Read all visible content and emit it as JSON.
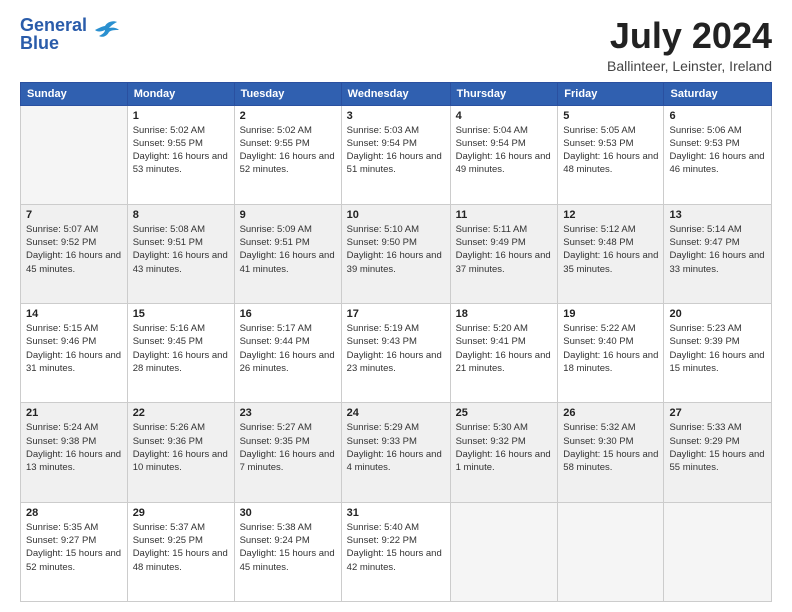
{
  "header": {
    "logo_line1": "General",
    "logo_line2": "Blue",
    "month_title": "July 2024",
    "subtitle": "Ballinteer, Leinster, Ireland"
  },
  "days_of_week": [
    "Sunday",
    "Monday",
    "Tuesday",
    "Wednesday",
    "Thursday",
    "Friday",
    "Saturday"
  ],
  "weeks": [
    [
      {
        "day": "",
        "empty": true
      },
      {
        "day": "1",
        "sunrise": "5:02 AM",
        "sunset": "9:55 PM",
        "daylight": "16 hours and 53 minutes."
      },
      {
        "day": "2",
        "sunrise": "5:02 AM",
        "sunset": "9:55 PM",
        "daylight": "16 hours and 52 minutes."
      },
      {
        "day": "3",
        "sunrise": "5:03 AM",
        "sunset": "9:54 PM",
        "daylight": "16 hours and 51 minutes."
      },
      {
        "day": "4",
        "sunrise": "5:04 AM",
        "sunset": "9:54 PM",
        "daylight": "16 hours and 49 minutes."
      },
      {
        "day": "5",
        "sunrise": "5:05 AM",
        "sunset": "9:53 PM",
        "daylight": "16 hours and 48 minutes."
      },
      {
        "day": "6",
        "sunrise": "5:06 AM",
        "sunset": "9:53 PM",
        "daylight": "16 hours and 46 minutes."
      }
    ],
    [
      {
        "day": "7",
        "sunrise": "5:07 AM",
        "sunset": "9:52 PM",
        "daylight": "16 hours and 45 minutes."
      },
      {
        "day": "8",
        "sunrise": "5:08 AM",
        "sunset": "9:51 PM",
        "daylight": "16 hours and 43 minutes."
      },
      {
        "day": "9",
        "sunrise": "5:09 AM",
        "sunset": "9:51 PM",
        "daylight": "16 hours and 41 minutes."
      },
      {
        "day": "10",
        "sunrise": "5:10 AM",
        "sunset": "9:50 PM",
        "daylight": "16 hours and 39 minutes."
      },
      {
        "day": "11",
        "sunrise": "5:11 AM",
        "sunset": "9:49 PM",
        "daylight": "16 hours and 37 minutes."
      },
      {
        "day": "12",
        "sunrise": "5:12 AM",
        "sunset": "9:48 PM",
        "daylight": "16 hours and 35 minutes."
      },
      {
        "day": "13",
        "sunrise": "5:14 AM",
        "sunset": "9:47 PM",
        "daylight": "16 hours and 33 minutes."
      }
    ],
    [
      {
        "day": "14",
        "sunrise": "5:15 AM",
        "sunset": "9:46 PM",
        "daylight": "16 hours and 31 minutes."
      },
      {
        "day": "15",
        "sunrise": "5:16 AM",
        "sunset": "9:45 PM",
        "daylight": "16 hours and 28 minutes."
      },
      {
        "day": "16",
        "sunrise": "5:17 AM",
        "sunset": "9:44 PM",
        "daylight": "16 hours and 26 minutes."
      },
      {
        "day": "17",
        "sunrise": "5:19 AM",
        "sunset": "9:43 PM",
        "daylight": "16 hours and 23 minutes."
      },
      {
        "day": "18",
        "sunrise": "5:20 AM",
        "sunset": "9:41 PM",
        "daylight": "16 hours and 21 minutes."
      },
      {
        "day": "19",
        "sunrise": "5:22 AM",
        "sunset": "9:40 PM",
        "daylight": "16 hours and 18 minutes."
      },
      {
        "day": "20",
        "sunrise": "5:23 AM",
        "sunset": "9:39 PM",
        "daylight": "16 hours and 15 minutes."
      }
    ],
    [
      {
        "day": "21",
        "sunrise": "5:24 AM",
        "sunset": "9:38 PM",
        "daylight": "16 hours and 13 minutes."
      },
      {
        "day": "22",
        "sunrise": "5:26 AM",
        "sunset": "9:36 PM",
        "daylight": "16 hours and 10 minutes."
      },
      {
        "day": "23",
        "sunrise": "5:27 AM",
        "sunset": "9:35 PM",
        "daylight": "16 hours and 7 minutes."
      },
      {
        "day": "24",
        "sunrise": "5:29 AM",
        "sunset": "9:33 PM",
        "daylight": "16 hours and 4 minutes."
      },
      {
        "day": "25",
        "sunrise": "5:30 AM",
        "sunset": "9:32 PM",
        "daylight": "16 hours and 1 minute."
      },
      {
        "day": "26",
        "sunrise": "5:32 AM",
        "sunset": "9:30 PM",
        "daylight": "15 hours and 58 minutes."
      },
      {
        "day": "27",
        "sunrise": "5:33 AM",
        "sunset": "9:29 PM",
        "daylight": "15 hours and 55 minutes."
      }
    ],
    [
      {
        "day": "28",
        "sunrise": "5:35 AM",
        "sunset": "9:27 PM",
        "daylight": "15 hours and 52 minutes."
      },
      {
        "day": "29",
        "sunrise": "5:37 AM",
        "sunset": "9:25 PM",
        "daylight": "15 hours and 48 minutes."
      },
      {
        "day": "30",
        "sunrise": "5:38 AM",
        "sunset": "9:24 PM",
        "daylight": "15 hours and 45 minutes."
      },
      {
        "day": "31",
        "sunrise": "5:40 AM",
        "sunset": "9:22 PM",
        "daylight": "15 hours and 42 minutes."
      },
      {
        "day": "",
        "empty": true
      },
      {
        "day": "",
        "empty": true
      },
      {
        "day": "",
        "empty": true
      }
    ]
  ]
}
